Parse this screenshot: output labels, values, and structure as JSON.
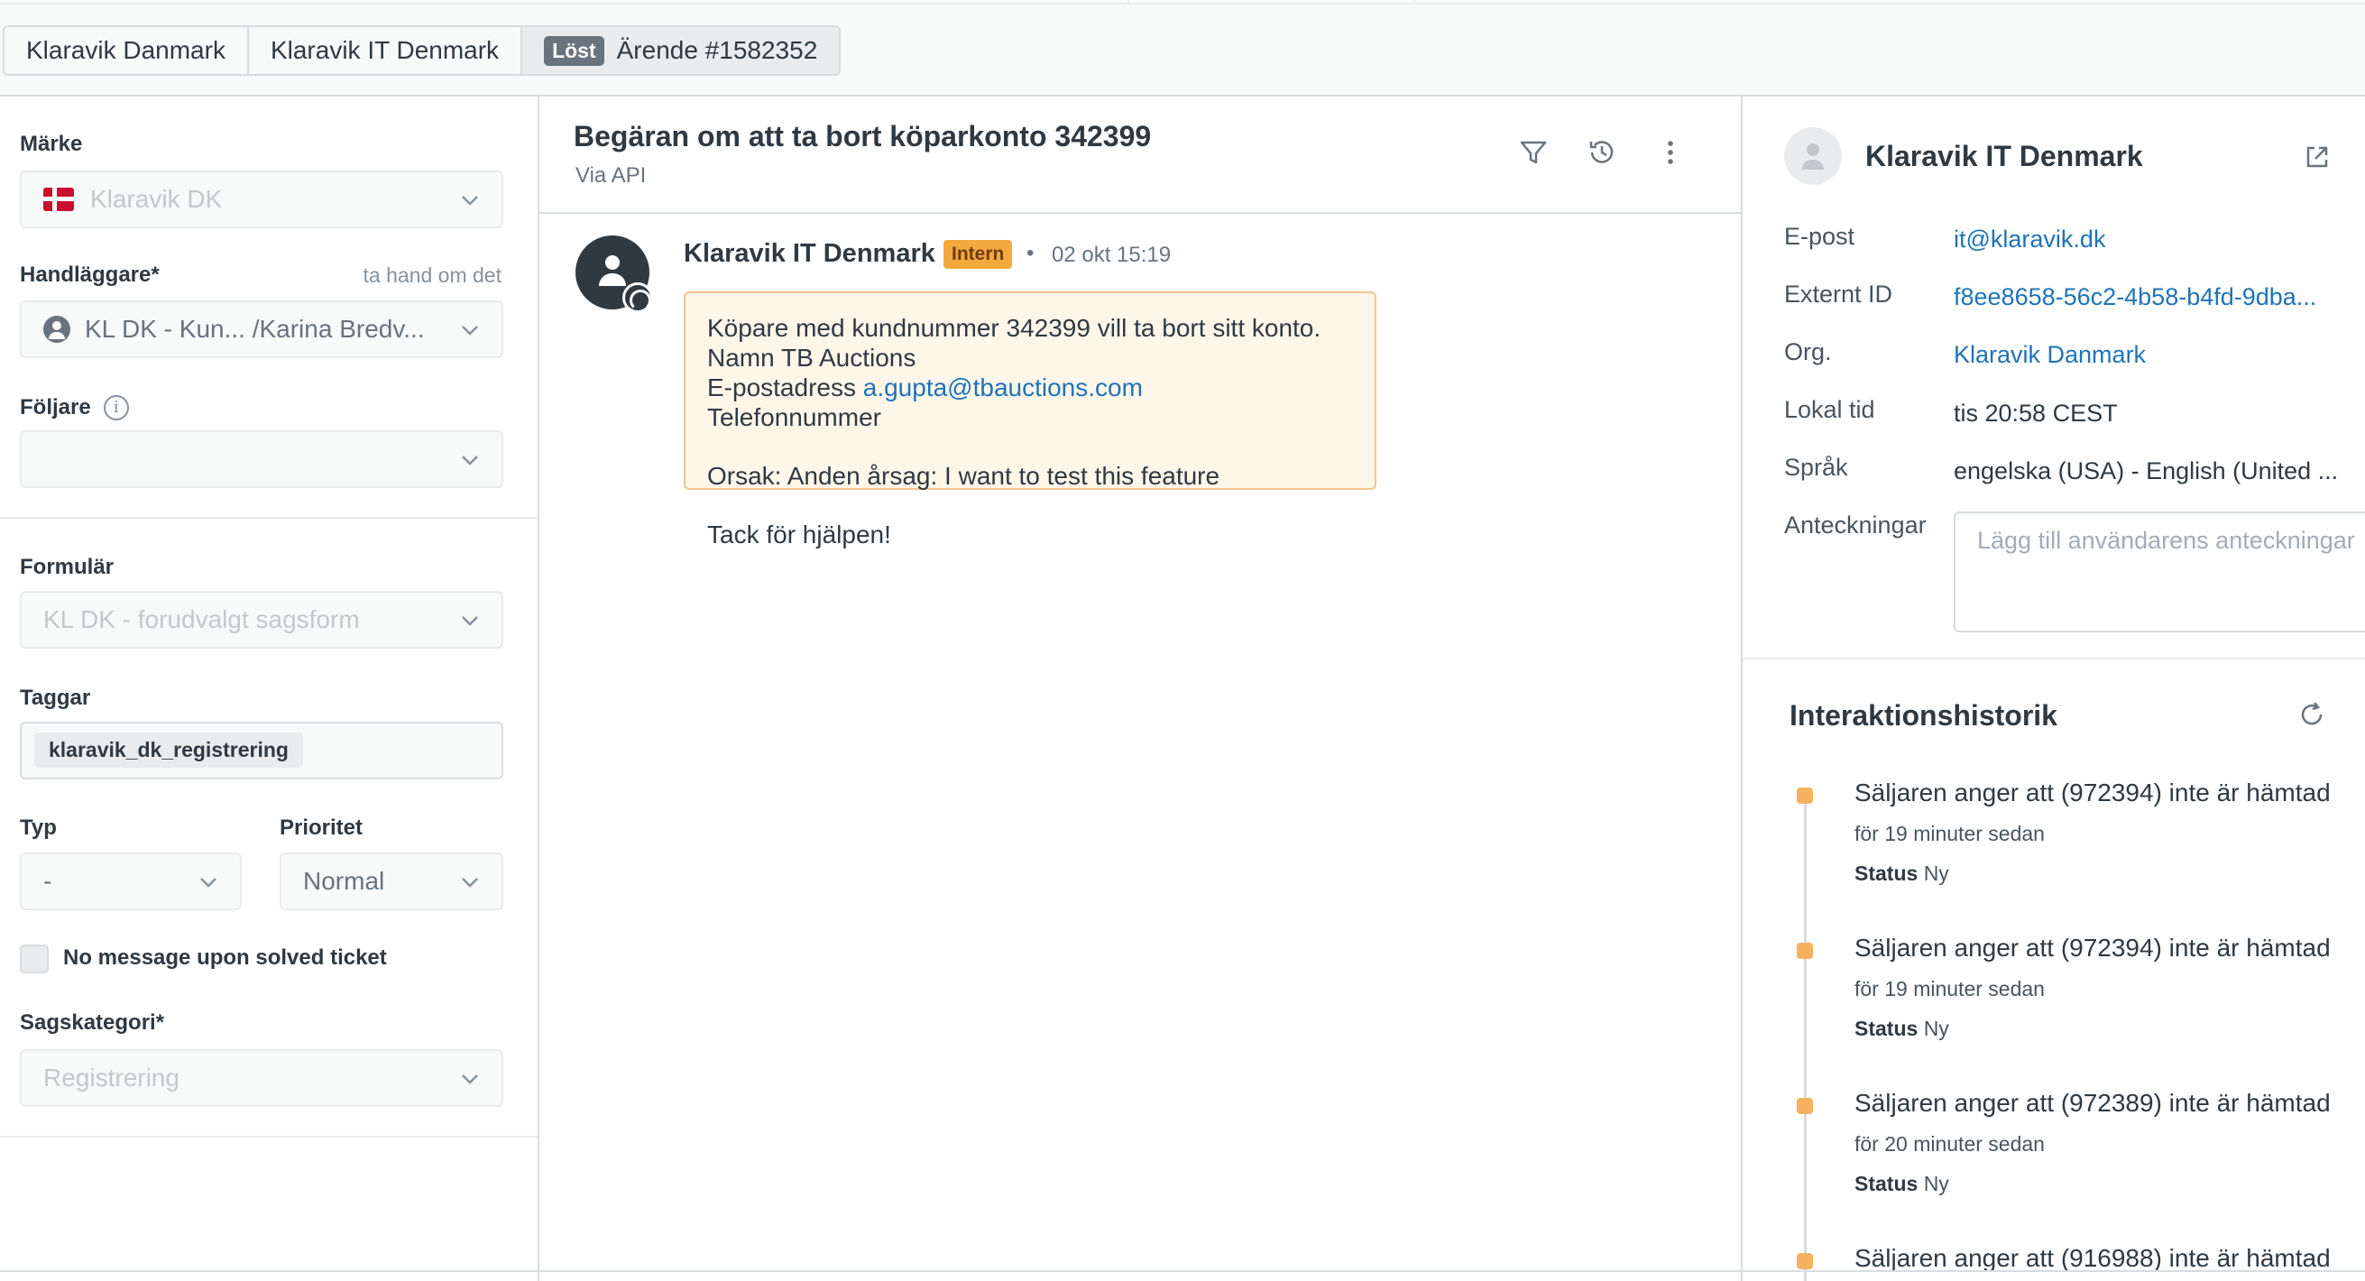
{
  "breadcrumb": {
    "items": [
      "Klaravik Danmark",
      "Klaravik IT Denmark"
    ],
    "status_badge": "Löst",
    "ticket_label": "Ärende #1582352"
  },
  "left": {
    "brand_label": "Märke",
    "brand_value": "Klaravik DK",
    "assignee_label": "Handläggare*",
    "assignee_hint": "ta hand om det",
    "assignee_value": "KL DK - Kun... /Karina Bredv...",
    "followers_label": "Följare",
    "form_label": "Formulär",
    "form_value": "KL DK - forudvalgt sagsform",
    "tags_label": "Taggar",
    "tag": "klaravik_dk_registrering",
    "type_label": "Typ",
    "type_value": "-",
    "priority_label": "Prioritet",
    "priority_value": "Normal",
    "checkbox_label": "No message upon solved ticket",
    "category_label": "Sagskategori*",
    "category_value": "Registrering"
  },
  "ticket": {
    "title": "Begäran om att ta bort köparkonto 342399",
    "via": "Via API",
    "message": {
      "author": "Klaravik IT Denmark",
      "badge": "Intern",
      "dot": "•",
      "time": "02 okt 15:19",
      "line1": "Köpare med kundnummer 342399 vill ta bort sitt konto.",
      "line2": "Namn TB Auctions",
      "line3_prefix": "E-postadress ",
      "line3_link": "a.gupta@tbauctions.com",
      "line4": "Telefonnummer",
      "line5": "Orsak: Anden årsag: I want to test this feature",
      "line6": "Tack för hjälpen!"
    }
  },
  "requester": {
    "name": "Klaravik IT Denmark",
    "fields": [
      {
        "key": "E-post",
        "value": "it@klaravik.dk"
      },
      {
        "key": "Externt ID",
        "value": "f8ee8658-56c2-4b58-b4fd-9dba..."
      },
      {
        "key": "Org.",
        "value": "Klaravik Danmark"
      },
      {
        "key": "Lokal tid",
        "value": "tis 20:58 CEST"
      },
      {
        "key": "Språk",
        "value": "engelska (USA) - English (United ..."
      },
      {
        "key": "Anteckningar",
        "value": ""
      }
    ],
    "notes_placeholder": "Lägg till användarens anteckningar"
  },
  "history": {
    "title": "Interaktionshistorik",
    "status_key": "Status",
    "events": [
      {
        "title": "Säljaren anger att (972394) inte är hämtad",
        "time": "för 19 minuter sedan",
        "status": "Ny"
      },
      {
        "title": "Säljaren anger att (972394) inte är hämtad",
        "time": "för 19 minuter sedan",
        "status": "Ny"
      },
      {
        "title": "Säljaren anger att (972389) inte är hämtad",
        "time": "för 20 minuter sedan",
        "status": "Ny"
      },
      {
        "title": "Säljaren anger att (916988) inte är hämtad",
        "time": "",
        "status": ""
      }
    ]
  },
  "colors": {
    "status_badge": "#68737d",
    "intern_badge": "#f4a93c",
    "link": "#1f73b7",
    "timeline_dot": "#f4b25f"
  }
}
